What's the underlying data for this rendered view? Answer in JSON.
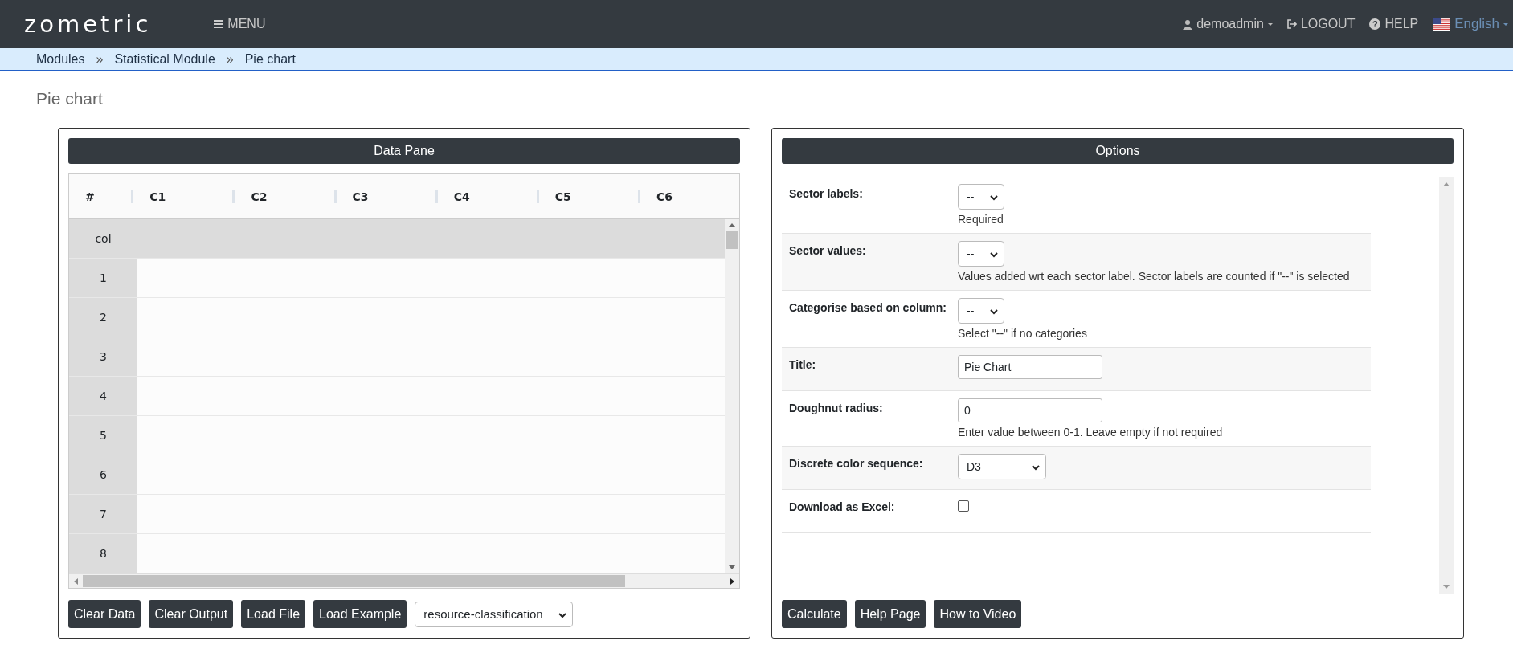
{
  "navbar": {
    "logo": "zometric",
    "menu": "MENU",
    "user": "demoadmin",
    "logout": "LOGOUT",
    "help_icon": "?",
    "help": "HELP",
    "language": "English"
  },
  "breadcrumb": [
    {
      "kind": "link",
      "text": "Modules"
    },
    {
      "kind": "separator",
      "text": "»"
    },
    {
      "kind": "link",
      "text": "Statistical Module"
    },
    {
      "kind": "separator",
      "text": "»"
    },
    {
      "kind": "link",
      "text": "Pie chart"
    }
  ],
  "page_title": "Pie chart",
  "data_pane": {
    "title": "Data Pane",
    "columns": [
      "#",
      "C1",
      "C2",
      "C3",
      "C4",
      "C5",
      "C6"
    ],
    "header_row": "col",
    "row_numbers": [
      "1",
      "2",
      "3",
      "4",
      "5",
      "6",
      "7",
      "8"
    ],
    "buttons": [
      "Clear Data",
      "Clear Output",
      "Load File",
      "Load Example"
    ],
    "example_select": "resource-classification"
  },
  "options": {
    "title": "Options",
    "rows": [
      {
        "kind": "select",
        "label": "Sector labels:",
        "value": "--",
        "hint": "Required"
      },
      {
        "kind": "select",
        "label": "Sector values:",
        "value": "--",
        "hint": "Values added wrt each sector label. Sector labels are counted if \"--\" is selected"
      },
      {
        "kind": "select",
        "label": "Categorise based on column:",
        "value": "--",
        "hint": "Select \"--\" if no categories"
      },
      {
        "kind": "input",
        "label": "Title:",
        "value": "Pie Chart"
      },
      {
        "kind": "input",
        "label": "Doughnut radius:",
        "value": "0",
        "hint": "Enter value between 0-1. Leave empty if not required"
      },
      {
        "kind": "wideselect",
        "label": "Discrete color sequence:",
        "value": "D3"
      },
      {
        "kind": "checkbox",
        "label": "Download as Excel:",
        "checked": false
      }
    ],
    "buttons": [
      "Calculate",
      "Help Page",
      "How to Video"
    ]
  }
}
